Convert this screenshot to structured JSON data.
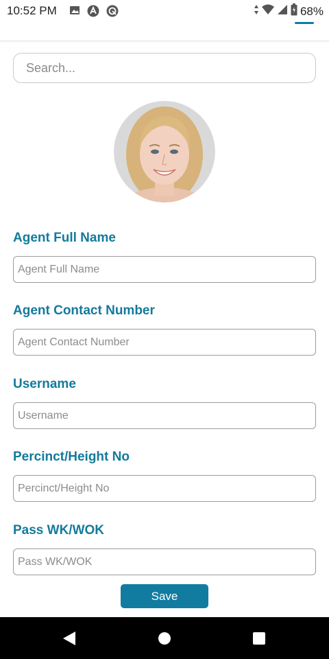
{
  "status_bar": {
    "time": "10:52 PM",
    "battery": "68%",
    "icons": [
      "image-icon",
      "app-a-icon",
      "sync-icon",
      "data-arrows-icon",
      "wifi-icon",
      "signal-icon",
      "battery-icon"
    ]
  },
  "search": {
    "placeholder": "Search..."
  },
  "profile": {
    "avatar": "avatar-photo"
  },
  "form": {
    "fields": [
      {
        "label": "Agent Full Name",
        "placeholder": "Agent Full Name"
      },
      {
        "label": "Agent Contact Number",
        "placeholder": "Agent Contact Number"
      },
      {
        "label": "Username",
        "placeholder": "Username"
      },
      {
        "label": "Percinct/Height No",
        "placeholder": "Percinct/Height No"
      },
      {
        "label": "Pass WK/WOK",
        "placeholder": "Pass WK/WOK"
      }
    ],
    "save_label": "Save"
  },
  "colors": {
    "accent": "#137a9c",
    "button": "#127ca0"
  },
  "nav_bar": {
    "icons": [
      "back-icon",
      "home-icon",
      "recents-icon"
    ]
  }
}
